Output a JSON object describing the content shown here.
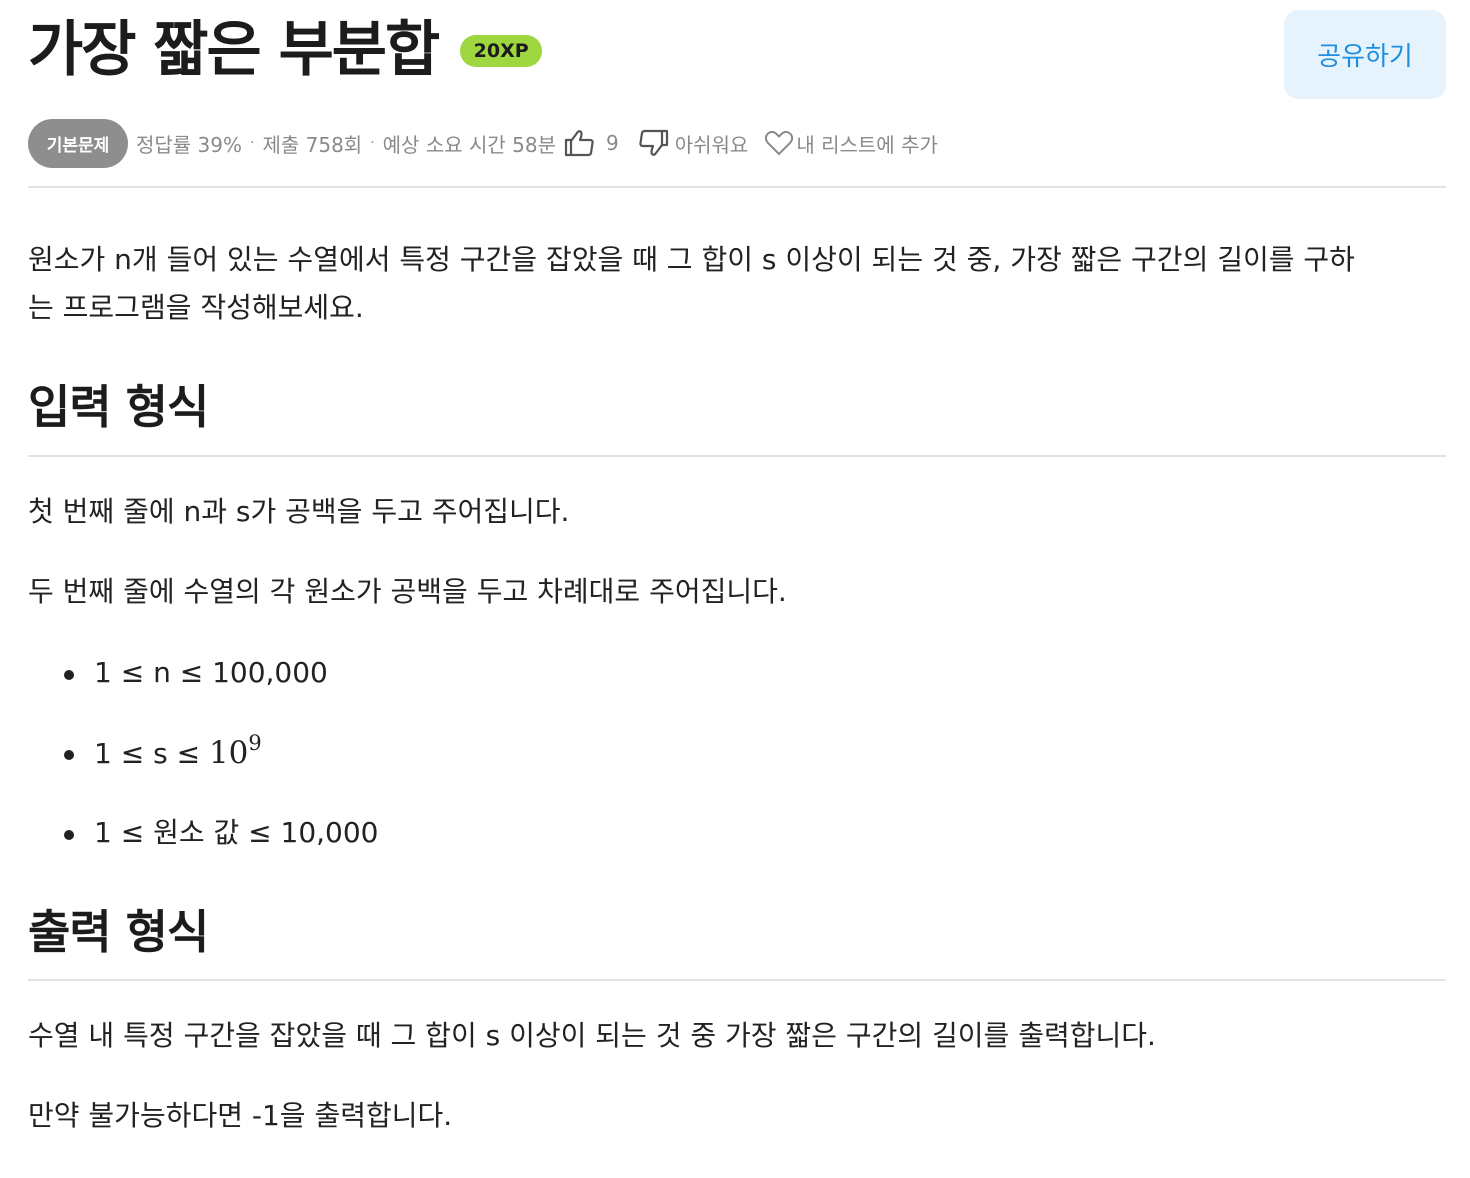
{
  "problem": {
    "title": "가장 짧은 부분합",
    "xp_badge": "20XP",
    "share_label": "공유하기"
  },
  "meta": {
    "level": "기본문제",
    "accuracy": "정답률 39%",
    "separator": "·",
    "submissions": "제출 758회",
    "estimated_time": "예상 소요 시간 58분",
    "like_count": "9",
    "dislike_label": "아쉬워요",
    "add_list_label": "내 리스트에 추가"
  },
  "description": {
    "line1": "원소가 n개 들어 있는 수열에서 특정 구간을 잡았을 때 그 합이 s 이상이 되는 것 중, 가장 짧은 구간의 길이를 구하",
    "line2": "는 프로그램을 작성해보세요."
  },
  "input_section": {
    "title": "입력 형식",
    "line1": "첫 번째 줄에 n과 s가 공백을 두고 주어집니다.",
    "line2": "두 번째 줄에 수열의 각 원소가 공백을 두고 차례대로 주어집니다.",
    "constraints": [
      {
        "text": "1 ≤ n ≤ 100,000"
      },
      {
        "prefix": "1 ≤ s ≤ ",
        "math_base": "10",
        "math_exp": "9"
      },
      {
        "text": "1 ≤ 원소 값 ≤ 10,000"
      }
    ]
  },
  "output_section": {
    "title": "출력 형식",
    "line1": "수열 내 특정 구간을 잡았을 때 그 합이 s 이상이 되는 것 중 가장 짧은 구간의 길이를 출력합니다.",
    "line2": "만약 불가능하다면 -1을 출력합니다."
  },
  "colors": {
    "xp_badge": "#9ed73f",
    "share_bg": "#e6f3fc",
    "share_text": "#1f8ee0",
    "level_badge": "#8e8e8e",
    "meta_text": "#8a8a8a"
  },
  "icons": [
    "thumbs-up-icon",
    "thumbs-down-icon",
    "heart-icon"
  ]
}
